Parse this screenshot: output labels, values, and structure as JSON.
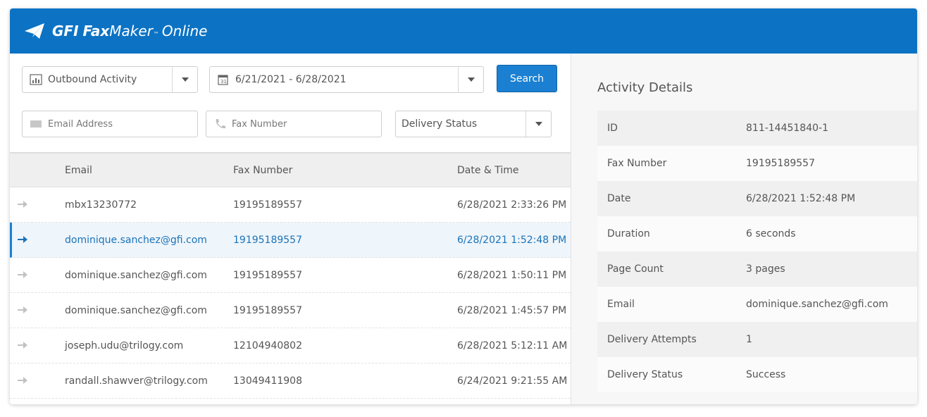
{
  "app": {
    "brand_gfi": "GFI",
    "brand_fax": "Fax",
    "brand_maker": "Maker",
    "brand_tm": "™",
    "brand_online": "Online",
    "accent_color": "#0c73c4"
  },
  "filters": {
    "activity_type": "Outbound Activity",
    "date_range": "6/21/2021 - 6/28/2021",
    "search_label": "Search",
    "email_placeholder": "Email Address",
    "fax_placeholder": "Fax Number",
    "delivery_status": "Delivery Status"
  },
  "table": {
    "columns": [
      "Email",
      "Fax Number",
      "Date & Time"
    ],
    "rows": [
      {
        "email": "mbx13230772",
        "fax": "19195189557",
        "datetime": "6/28/2021 2:33:26 PM"
      },
      {
        "email": "dominique.sanchez@gfi.com",
        "fax": "19195189557",
        "datetime": "6/28/2021 1:52:48 PM",
        "selected": true
      },
      {
        "email": "dominique.sanchez@gfi.com",
        "fax": "19195189557",
        "datetime": "6/28/2021 1:50:11 PM"
      },
      {
        "email": "dominique.sanchez@gfi.com",
        "fax": "19195189557",
        "datetime": "6/28/2021 1:45:57 PM"
      },
      {
        "email": "joseph.udu@trilogy.com",
        "fax": "12104940802",
        "datetime": "6/28/2021 5:12:11 AM"
      },
      {
        "email": "randall.shawver@trilogy.com",
        "fax": "13049411908",
        "datetime": "6/24/2021 9:21:55 AM"
      }
    ]
  },
  "details": {
    "title": "Activity Details",
    "items": [
      {
        "key": "ID",
        "value": "811-14451840-1"
      },
      {
        "key": "Fax Number",
        "value": "19195189557"
      },
      {
        "key": "Date",
        "value": "6/28/2021 1:52:48 PM"
      },
      {
        "key": "Duration",
        "value": "6 seconds"
      },
      {
        "key": "Page Count",
        "value": "3 pages"
      },
      {
        "key": "Email",
        "value": "dominique.sanchez@gfi.com"
      },
      {
        "key": "Delivery Attempts",
        "value": "1"
      },
      {
        "key": "Delivery Status",
        "value": "Success"
      }
    ]
  }
}
